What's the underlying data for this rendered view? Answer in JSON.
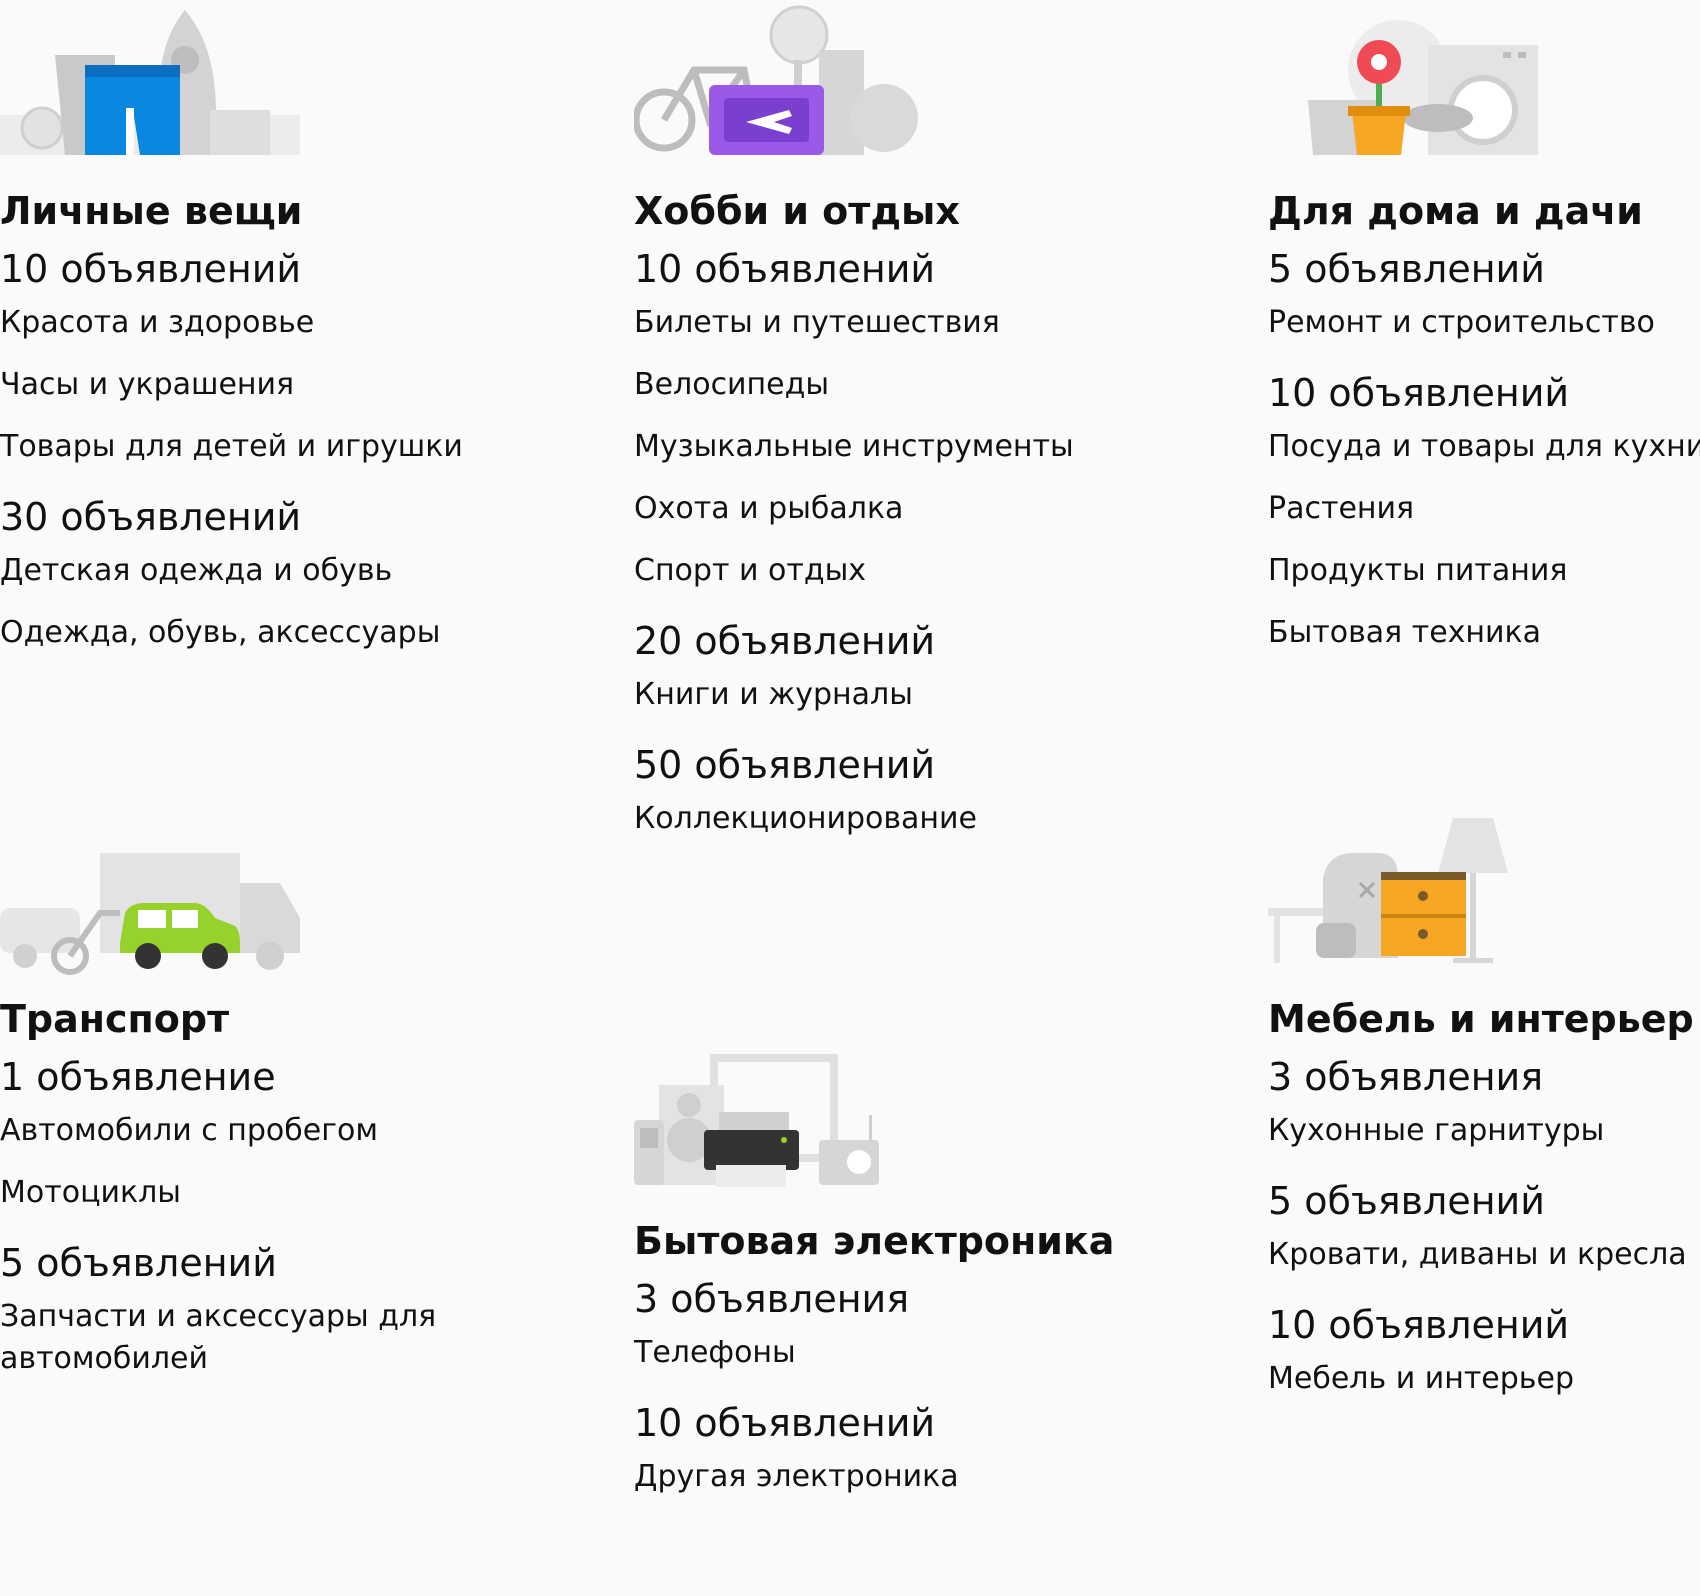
{
  "categories": [
    {
      "title": "Личные вещи",
      "groups": [
        {
          "count": "10 объявлений",
          "items": [
            "Красота и здоровье",
            "Часы и украшения",
            "Товары для детей и игрушки"
          ]
        },
        {
          "count": "30 объявлений",
          "items": [
            "Детская одежда и обувь",
            "Одежда, обувь, аксессуары"
          ]
        }
      ]
    },
    {
      "title": "Хобби и отдых",
      "groups": [
        {
          "count": "10 объявлений",
          "items": [
            "Билеты и путешествия",
            "Велосипеды",
            "Музыкальные инструменты",
            "Охота и рыбалка",
            "Спорт и отдых"
          ]
        },
        {
          "count": "20 объявлений",
          "items": [
            "Книги и журналы"
          ]
        },
        {
          "count": "50 объявлений",
          "items": [
            "Коллекционирование"
          ]
        }
      ]
    },
    {
      "title": "Для дома и дачи",
      "groups": [
        {
          "count": "5 объявлений",
          "items": [
            "Ремонт и строительство"
          ]
        },
        {
          "count": "10 объявлений",
          "items": [
            "Посуда и товары для кухни",
            "Растения",
            "Продукты питания",
            "Бытовая техника"
          ]
        }
      ]
    },
    {
      "title": "Транспорт",
      "groups": [
        {
          "count": "1 объявление",
          "items": [
            "Автомобили с пробегом",
            "Мотоциклы"
          ]
        },
        {
          "count": "5 объявлений",
          "items": [
            "Запчасти и аксессуары для автомобилей"
          ]
        }
      ]
    },
    {
      "title": "Бытовая электроника",
      "groups": [
        {
          "count": "3 объявления",
          "items": [
            "Телефоны"
          ]
        },
        {
          "count": "10 объявлений",
          "items": [
            "Другая электроника"
          ]
        }
      ]
    },
    {
      "title": "Мебель и интерьер",
      "groups": [
        {
          "count": "3 объявления",
          "items": [
            "Кухонные гарнитуры"
          ]
        },
        {
          "count": "5 объявлений",
          "items": [
            "Кровати, диваны и кресла"
          ]
        },
        {
          "count": "10 объявлений",
          "items": [
            "Мебель и интерьер"
          ]
        }
      ]
    }
  ],
  "illustrations": [
    "personal-items-icon",
    "hobby-icon",
    "home-garden-icon",
    "transport-icon",
    "electronics-icon",
    "furniture-icon"
  ],
  "colors": {
    "blue": "#0a88e0",
    "purple": "#9b59e8",
    "green": "#97d12c",
    "orange": "#f5a623",
    "red": "#f04b55",
    "gray": "#d6d6d6"
  }
}
